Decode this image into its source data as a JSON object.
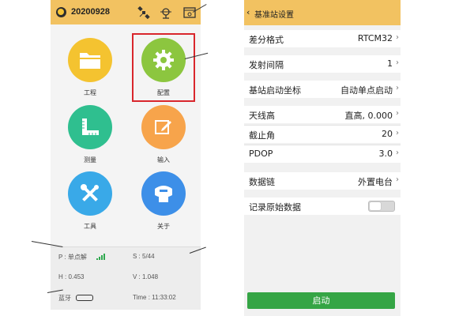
{
  "left_phone": {
    "title": "20200928",
    "apps": [
      {
        "label": "工程",
        "icon": "folder-icon",
        "color": "#f4c330"
      },
      {
        "label": "配置",
        "icon": "gear-icon",
        "color": "#8cc63f"
      },
      {
        "label": "测量",
        "icon": "ruler-icon",
        "color": "#2fbf8f"
      },
      {
        "label": "输入",
        "icon": "edit-icon",
        "color": "#f7a44b"
      },
      {
        "label": "工具",
        "icon": "tools-icon",
        "color": "#39a9e8"
      },
      {
        "label": "关于",
        "icon": "receiver-icon",
        "color": "#3d8fe8"
      }
    ],
    "status": {
      "p": "P : 单点解",
      "s": "S : 5/44",
      "h": "H : 0.453",
      "v": "V : 1.048",
      "bt": "蓝牙",
      "time": "Time :  11:33:02"
    }
  },
  "right_phone": {
    "title": "基准站设置",
    "rows": [
      {
        "label": "差分格式",
        "value": "RTCM32"
      },
      {
        "label": "发射间隔",
        "value": "1"
      },
      {
        "label": "基站启动坐标",
        "value": "自动单点启动"
      },
      {
        "label": "天线高",
        "value": "直高, 0.000"
      },
      {
        "label": "截止角",
        "value": "20"
      },
      {
        "label": "PDOP",
        "value": "3.0"
      },
      {
        "label": "数据链",
        "value": "外置电台"
      }
    ],
    "record_raw": {
      "label": "记录原始数据",
      "enabled": false
    },
    "start_button": "启动"
  },
  "colors": {
    "header": "#f2c261",
    "accent_green": "#35a545",
    "highlight_red": "#d9262c"
  }
}
